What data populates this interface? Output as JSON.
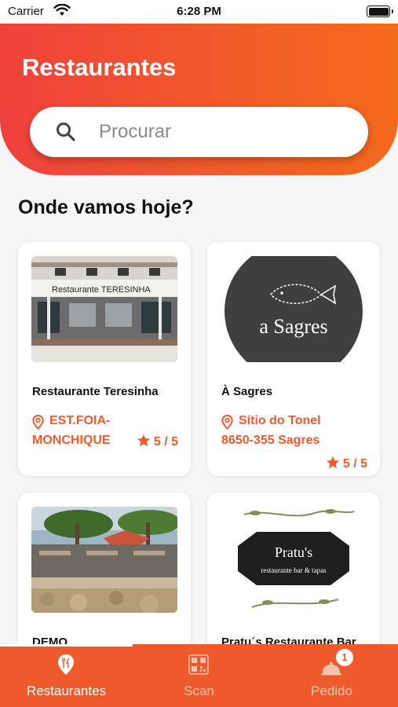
{
  "status_bar": {
    "carrier": "Carrier",
    "time": "6:28 PM"
  },
  "header": {
    "title": "Restaurantes",
    "search_placeholder": "Procurar",
    "colors": {
      "gradient_start": "#f0413c",
      "gradient_end": "#f26a1c"
    }
  },
  "section_title": "Onde vamos hoje?",
  "restaurants": [
    {
      "name": "Restaurante Teresinha",
      "address_line1": "EST.FOIA-",
      "address_line2": "MONCHIQUE",
      "rating": "5 / 5",
      "image_sign": "Restaurante TERESINHA"
    },
    {
      "name": "À Sagres",
      "address_line1": "Sítio do Tonel",
      "address_line2": "8650-355 Sagres",
      "rating": "5 / 5",
      "logo_text": "a Sagres"
    },
    {
      "name": "DEMO"
    },
    {
      "name": "Pratu´s Restaurante Bar",
      "logo_title": "Pratu's",
      "logo_subtitle": "restaurante bar & tapas"
    }
  ],
  "tabbar": {
    "tabs": [
      {
        "label": "Restaurantes",
        "icon": "restaurant-pin-icon",
        "active": true
      },
      {
        "label": "Scan",
        "icon": "qr-code-icon",
        "active": false
      },
      {
        "label": "Pedido",
        "icon": "cloche-icon",
        "active": false,
        "badge": "1"
      }
    ]
  },
  "colors": {
    "accent": "#ef5a2c",
    "background": "#f6f6f6"
  }
}
